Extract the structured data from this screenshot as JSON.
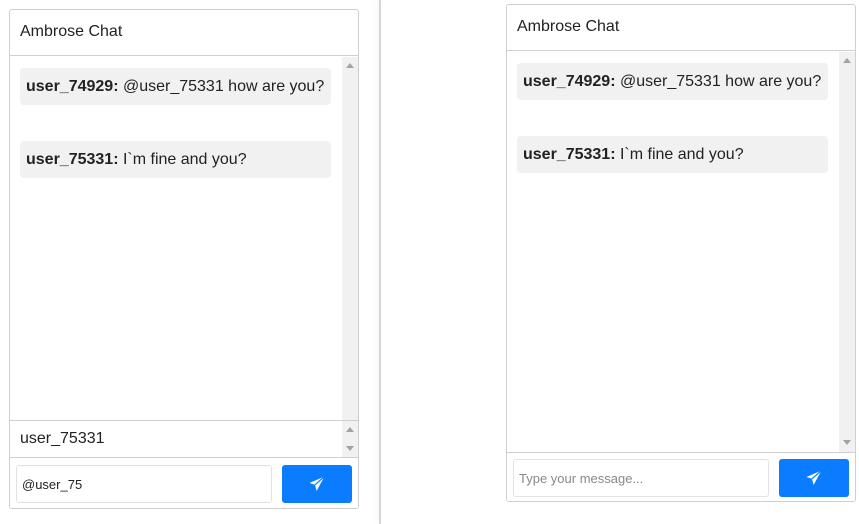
{
  "left_chat": {
    "title": "Ambrose Chat",
    "messages": [
      {
        "user": "user_74929:",
        "text": " @user_75331 how are you?"
      },
      {
        "user": "user_75331:",
        "text": " I`m fine and you?"
      }
    ],
    "mention_suggestion": "user_75331",
    "input": {
      "value": "@user_75",
      "placeholder": "Type your message..."
    },
    "send_icon": "paper-plane-icon"
  },
  "right_chat": {
    "title": "Ambrose Chat",
    "messages": [
      {
        "user": "user_74929:",
        "text": " @user_75331 how are you?"
      },
      {
        "user": "user_75331:",
        "text": " I`m fine and you?"
      }
    ],
    "input": {
      "value": "",
      "placeholder": "Type your message..."
    },
    "send_icon": "paper-plane-icon"
  },
  "colors": {
    "send_button": "#0a7cff",
    "message_bg": "#f1f1f1",
    "border": "#cfcfcf"
  }
}
